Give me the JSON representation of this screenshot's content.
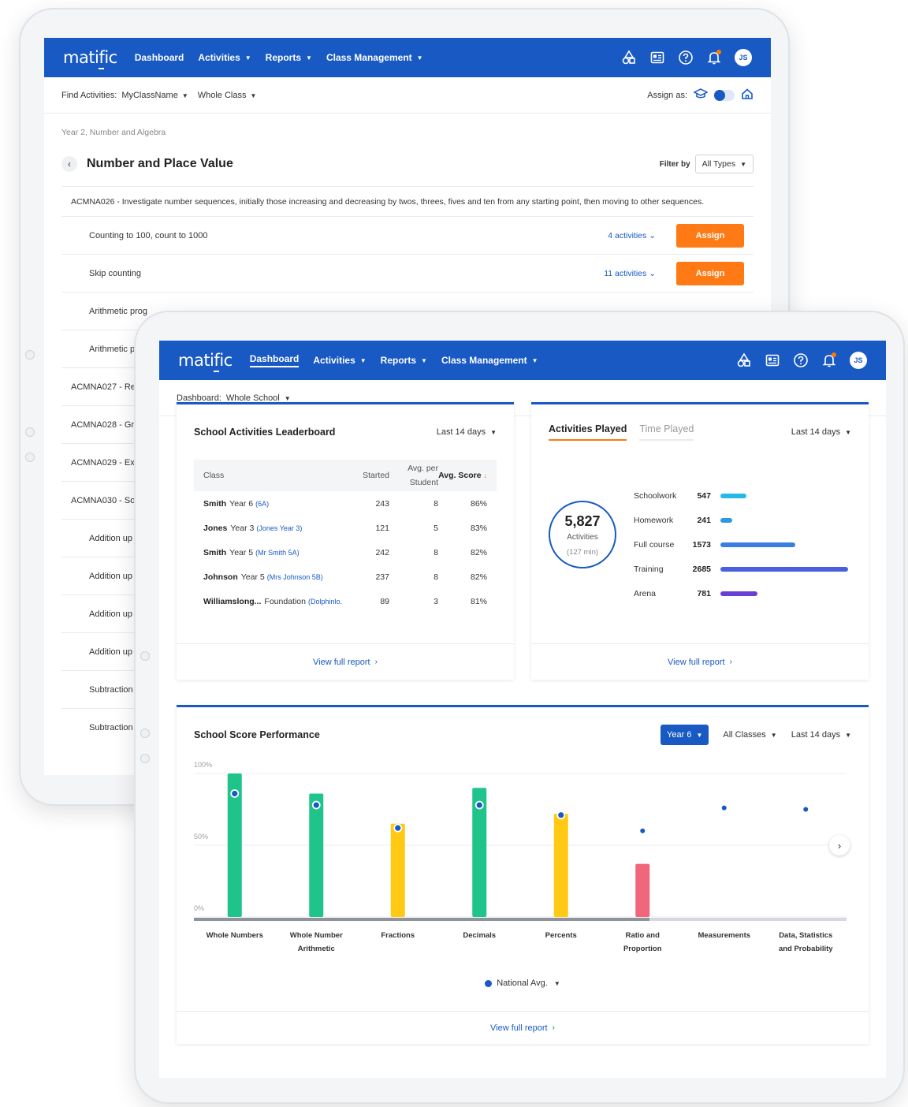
{
  "nav": {
    "logo": "matific",
    "items": [
      {
        "label": "Dashboard",
        "caret": ""
      },
      {
        "label": "Activities",
        "caret": "▼"
      },
      {
        "label": "Reports",
        "caret": "▼"
      },
      {
        "label": "Class Management",
        "caret": "▼"
      }
    ],
    "avatar": "JS"
  },
  "activities_screen": {
    "find_label": "Find Activities:",
    "class_select": "MyClassName",
    "group_select": "Whole Class",
    "assign_as": "Assign as:",
    "breadcrumb": "Year 2, Number and Algebra",
    "title": "Number and Place Value",
    "filter_label": "Filter by",
    "filter_value": "All Types",
    "standard": "ACMNA026 - Investigate number sequences, initially those increasing and decreasing by twos, threes, fives and ten from any starting point, then moving to other sequences.",
    "rows": [
      {
        "label": "Counting to 100, count to 1000",
        "activities": "4 activities",
        "assign": "Assign"
      },
      {
        "label": "Skip counting",
        "activities": "11 activities",
        "assign": "Assign"
      },
      {
        "label": "Arithmetic prog"
      },
      {
        "label": "Arithmetic pr"
      },
      {
        "label": "ACMNA027 - Reco",
        "std": true
      },
      {
        "label": "ACMNA028 - Grou",
        "std": true
      },
      {
        "label": "ACMNA029 - Expl",
        "std": true
      },
      {
        "label": "ACMNA030 - Solve",
        "std": true
      },
      {
        "label": "Addition up t"
      },
      {
        "label": "Addition up to"
      },
      {
        "label": "Addition up to"
      },
      {
        "label": "Addition up to"
      },
      {
        "label": "Subtraction p"
      },
      {
        "label": "Subtraction u"
      }
    ]
  },
  "dashboard": {
    "label": "Dashboard:",
    "scope": "Whole School",
    "leaderboard": {
      "title": "School Activities Leaderboard",
      "range": "Last 14 days",
      "headers": {
        "class": "Class",
        "started": "Started",
        "avg_per_student": "Avg. per Student",
        "avg_score": "Avg. Score"
      },
      "rows": [
        {
          "name": "Smith",
          "year": "Year 6",
          "sub": "(6A)",
          "started": "243",
          "avg": "8",
          "score": "86%"
        },
        {
          "name": "Jones",
          "year": "Year 3",
          "sub": "(Jones Year 3)",
          "started": "121",
          "avg": "5",
          "score": "83%"
        },
        {
          "name": "Smith",
          "year": "Year 5",
          "sub": "(Mr Smith 5A)",
          "started": "242",
          "avg": "8",
          "score": "82%"
        },
        {
          "name": "Johnson",
          "year": "Year 5",
          "sub": "(Mrs Johnson 5B)",
          "started": "237",
          "avg": "8",
          "score": "82%"
        },
        {
          "name": "Williamslong...",
          "year": "Foundation",
          "sub": "(Dolphinlo...)",
          "started": "89",
          "avg": "3",
          "score": "81%"
        }
      ],
      "footer": "View full report"
    },
    "activities_played": {
      "tab_on": "Activities Played",
      "tab_off": "Time Played",
      "range": "Last 14 days",
      "total": "5,827",
      "total_label": "Activities",
      "total_time": "(127 min)",
      "footer": "View full report"
    },
    "performance": {
      "title": "School Score Performance",
      "year": "Year 6",
      "classes": "All Classes",
      "range": "Last 14 days",
      "legend": "National Avg.",
      "footer": "View full report"
    }
  },
  "colors": {
    "brand": "#1859c4",
    "accent": "#ff7a14",
    "green": "#1fc48a",
    "yellow": "#ffc914",
    "red": "#f0667a"
  },
  "chart_data": [
    {
      "type": "bar",
      "title": "Activities Played",
      "categories": [
        "Schoolwork",
        "Homework",
        "Full course",
        "Training",
        "Arena"
      ],
      "values": [
        547,
        241,
        1573,
        2685,
        781
      ],
      "colors": [
        "#25b9e8",
        "#2b9ae0",
        "#3a7fe0",
        "#4a5fe0",
        "#6a3fd8"
      ]
    },
    {
      "type": "bar",
      "title": "School Score Performance",
      "categories": [
        "Whole Numbers",
        "Whole Number Arithmetic",
        "Fractions",
        "Decimals",
        "Percents",
        "Ratio and Proportion",
        "Measurements",
        "Data, Statistics and Probability"
      ],
      "series": [
        {
          "values": [
            100,
            86,
            65,
            90,
            72,
            37,
            null,
            null
          ]
        },
        {
          "name": "National Avg.",
          "values": [
            86,
            78,
            62,
            78,
            71,
            60,
            76,
            75
          ]
        }
      ],
      "bar_colors": [
        "#1fc48a",
        "#1fc48a",
        "#ffc914",
        "#1fc48a",
        "#ffc914",
        "#f0667a",
        "",
        ""
      ],
      "ylim": [
        0,
        100
      ],
      "yticks": [
        "100%",
        "50%",
        "0%"
      ],
      "grid": true
    }
  ]
}
